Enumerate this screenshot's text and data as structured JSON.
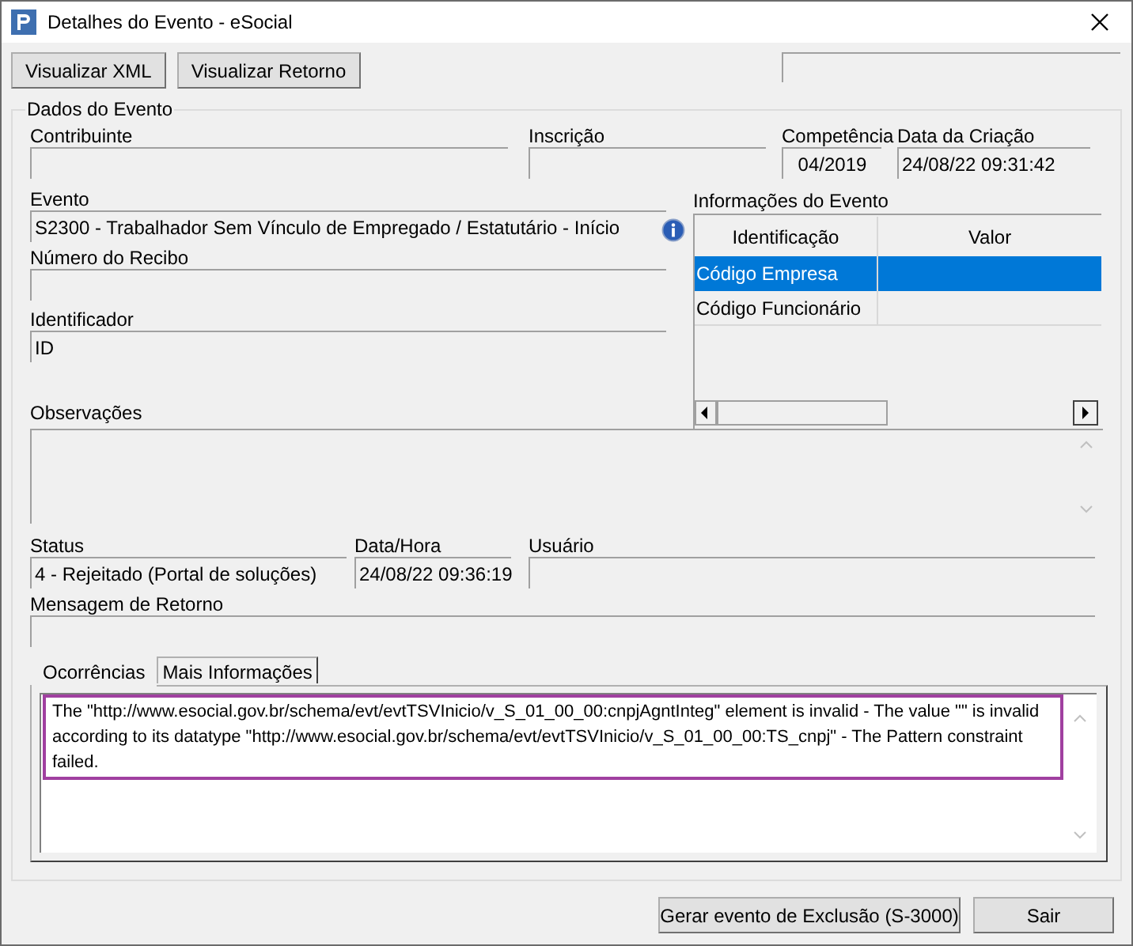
{
  "window": {
    "title": "Detalhes do Evento - eSocial"
  },
  "toolbar": {
    "buttons": [
      "Visualizar XML",
      "Visualizar Retorno"
    ]
  },
  "group": {
    "title": "Dados do Evento"
  },
  "row1": [
    {
      "label": "Contribuinte"
    },
    {
      "label": "Inscrição"
    },
    {
      "label": "Competência",
      "value": "04/2019"
    },
    {
      "label": "Data da Criação",
      "value": "24/08/22 09:31:42"
    }
  ],
  "left_fields": [
    {
      "label": "Evento",
      "value": "S2300 - Trabalhador Sem Vínculo de Empregado / Estatutário - Início"
    },
    {
      "label": "Número do Recibo"
    },
    {
      "label": "Identificador",
      "value": "ID"
    }
  ],
  "event_info": {
    "label": "Informações do Evento",
    "columns": [
      "Identificação",
      "Valor"
    ],
    "rows": [
      {
        "cells": [
          "Código Empresa"
        ],
        "selected": true
      },
      {
        "cells": [
          "Código Funcionário"
        ],
        "selected": false
      }
    ]
  },
  "observacoes": {
    "label": "Observações"
  },
  "row2": [
    {
      "label": "Status",
      "value": "4 - Rejeitado (Portal de soluções)"
    },
    {
      "label": "Data/Hora",
      "value": "24/08/22 09:36:19"
    },
    {
      "label": "Usuário"
    }
  ],
  "mensagem": {
    "label": "Mensagem de Retorno"
  },
  "tabs": [
    {
      "label": "Ocorrências",
      "selected": true
    },
    {
      "label": "Mais Informações",
      "selected": false
    }
  ],
  "occurrence": "The \"http://www.esocial.gov.br/schema/evt/evtTSVInicio/v_S_01_00_00:cnpjAgntInteg\" element is invalid - The value \"\" is invalid according to its datatype \"http://www.esocial.gov.br/schema/evt/evtTSVInicio/v_S_01_00_00:TS_cnpj\" - The Pattern constraint failed.",
  "footer_buttons": [
    "Gerar evento de Exclusão (S-3000)",
    "Sair"
  ]
}
